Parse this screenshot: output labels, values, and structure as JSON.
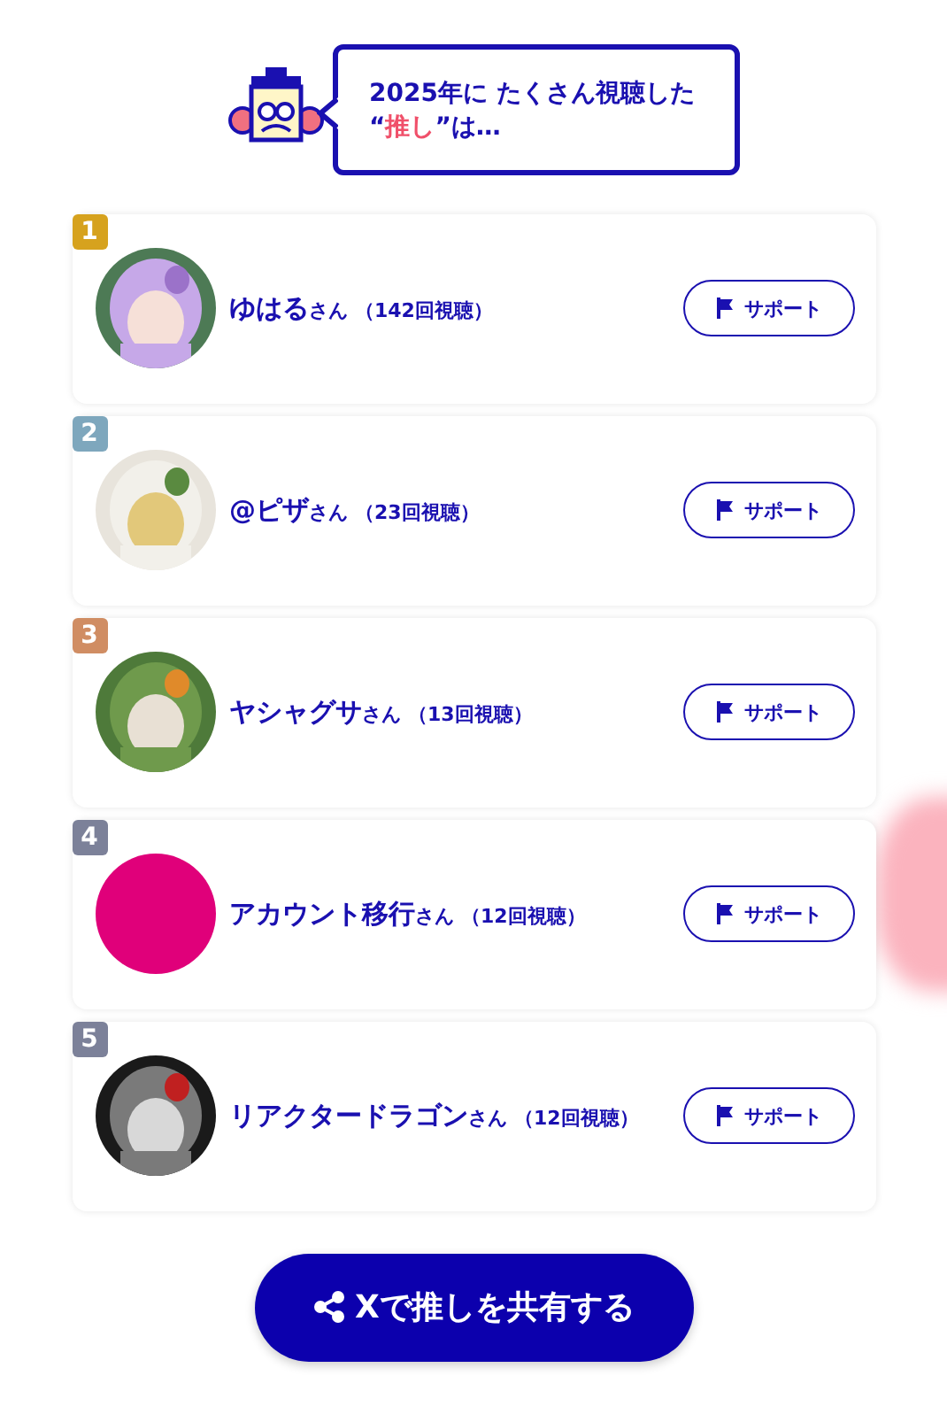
{
  "header": {
    "before": "2025年に たくさん視聴した “",
    "highlight": "推し",
    "after": "”は…"
  },
  "ranking": [
    {
      "rank": "1",
      "color": "#d6a21e",
      "name": "ゆはる",
      "honorific": "さん",
      "views": "（142回視聴）",
      "button": "サポート"
    },
    {
      "rank": "2",
      "color": "#7ea7bd",
      "name": "@ピザ",
      "honorific": "さん",
      "views": "（23回視聴）",
      "button": "サポート"
    },
    {
      "rank": "3",
      "color": "#d08d63",
      "name": "ヤシャグサ",
      "honorific": "さん",
      "views": "（13回視聴）",
      "button": "サポート"
    },
    {
      "rank": "4",
      "color": "#7c8199",
      "avatar": {
        "kind": "plain",
        "color": "#e0007a"
      },
      "name": "アカウント移行",
      "honorific": "さん",
      "views": "（12回視聴）",
      "button": "サポート"
    },
    {
      "rank": "5",
      "color": "#7c8199",
      "name": "リアクタードラゴン",
      "honorific": "さん",
      "views": "（12回視聴）",
      "button": "サポート"
    }
  ],
  "share_button": "Xで推しを共有する"
}
